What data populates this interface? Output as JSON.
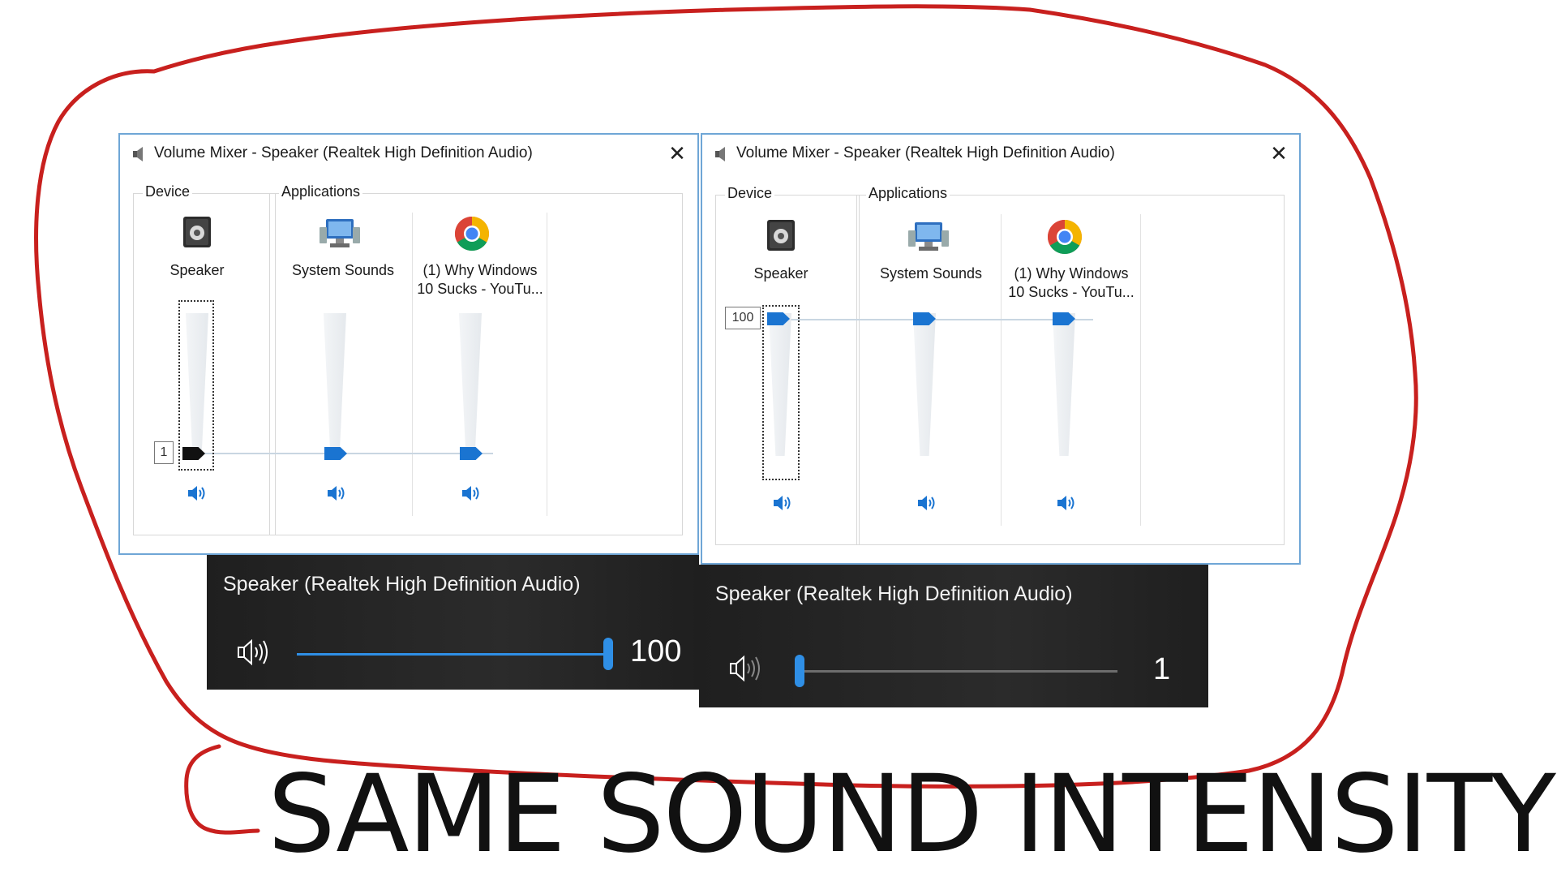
{
  "windows": [
    {
      "title": "Volume Mixer - Speaker (Realtek High Definition Audio)",
      "device_label": "Device",
      "applications_label": "Applications",
      "device_level_text": "1",
      "channels": [
        {
          "name": "Speaker",
          "icon": "speaker-device-icon",
          "level": 1
        },
        {
          "name": "System Sounds",
          "icon": "system-sounds-icon",
          "level": 1
        },
        {
          "name": "(1) Why Windows\n10 Sucks - YouTu...",
          "icon": "chrome-icon",
          "level": 1
        }
      ]
    },
    {
      "title": "Volume Mixer - Speaker (Realtek High Definition Audio)",
      "device_label": "Device",
      "applications_label": "Applications",
      "device_level_text": "100",
      "channels": [
        {
          "name": "Speaker",
          "icon": "speaker-device-icon",
          "level": 100
        },
        {
          "name": "System Sounds",
          "icon": "system-sounds-icon",
          "level": 100
        },
        {
          "name": "(1) Why Windows\n10 Sucks - YouTu...",
          "icon": "chrome-icon",
          "level": 100
        }
      ]
    }
  ],
  "flyouts": [
    {
      "device": "Speaker (Realtek High Definition Audio)",
      "value": "100",
      "level": 100
    },
    {
      "device": "Speaker (Realtek High Definition Audio)",
      "value": "1",
      "level": 1
    }
  ],
  "caption": "SAME SOUND INTENSITY",
  "colors": {
    "annotation": "#c8201e",
    "accent": "#1a74d1",
    "flyout_accent": "#2f8fe6"
  }
}
